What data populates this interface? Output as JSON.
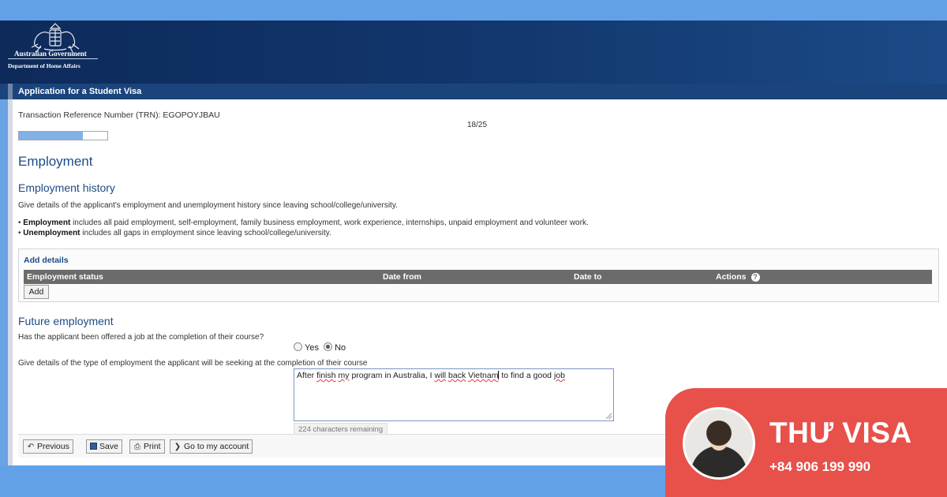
{
  "header": {
    "gov_name": "Australian Government",
    "department": "Department of Home Affairs",
    "crest_icon": "commonwealth-coat-of-arms-icon"
  },
  "app": {
    "title": "Application for a Student Visa"
  },
  "progress": {
    "trn_label": "Transaction Reference Number (TRN): EGOPOYJBAU",
    "count": "18/25",
    "fraction": 0.72
  },
  "employment": {
    "heading": "Employment",
    "history_heading": "Employment history",
    "intro": "Give details of the applicant's employment and unemployment history since leaving school/college/university.",
    "employment_term": "Employment",
    "employment_desc": " includes all paid employment, self-employment, family business employment, work experience, internships, unpaid employment and volunteer work.",
    "unemployment_term": "Unemployment",
    "unemployment_desc": " includes all gaps in employment since leaving school/college/university."
  },
  "details_table": {
    "title": "Add details",
    "columns": [
      "Employment status",
      "Date from",
      "Date to",
      "Actions"
    ],
    "add_label": "Add",
    "help_icon": "question-circle-icon"
  },
  "future": {
    "heading": "Future employment",
    "question_offered": "Has the applicant been offered a job at the completion of their course?",
    "option_yes": "Yes",
    "option_no": "No",
    "selected": "No",
    "question_details": "Give details of the type of employment the applicant will be seeking at the completion of their course",
    "answer_parts": [
      "After ",
      "finish",
      " ",
      "my",
      " program in Australia, I ",
      "will",
      " ",
      "back",
      " ",
      "Vietnam",
      " to find a good ",
      "job"
    ],
    "chars_remaining": "224 characters remaining"
  },
  "nav": {
    "previous": "Previous",
    "save": "Save",
    "print": "Print",
    "account": "Go to my account"
  },
  "promo": {
    "brand": "THƯ VISA",
    "phone": "+84 906 199 990",
    "accent_color": "#e8504a"
  }
}
